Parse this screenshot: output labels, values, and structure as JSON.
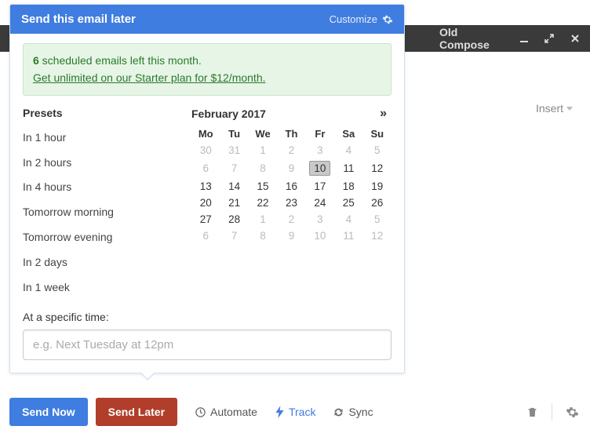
{
  "oldCompose": {
    "title": "Old Compose"
  },
  "insert": {
    "label": "Insert"
  },
  "popover": {
    "title": "Send this email later",
    "customize": "Customize"
  },
  "promo": {
    "count": "6",
    "rest": " scheduled emails left this month.",
    "link": "Get unlimited on our Starter plan for $12/month."
  },
  "presets": {
    "header": "Presets",
    "items": [
      "In 1 hour",
      "In 2 hours",
      "In 4 hours",
      "Tomorrow morning",
      "Tomorrow evening",
      "In 2 days",
      "In 1 week"
    ]
  },
  "calendar": {
    "month": "February 2017",
    "next": "»",
    "dow": [
      "Mo",
      "Tu",
      "We",
      "Th",
      "Fr",
      "Sa",
      "Su"
    ],
    "selected": 10,
    "rows": [
      [
        {
          "d": 30,
          "o": true
        },
        {
          "d": 31,
          "o": true
        },
        {
          "d": 1,
          "o": true
        },
        {
          "d": 2,
          "o": true
        },
        {
          "d": 3,
          "o": true
        },
        {
          "d": 4,
          "o": true
        },
        {
          "d": 5,
          "o": true
        }
      ],
      [
        {
          "d": 6,
          "o": true
        },
        {
          "d": 7,
          "o": true
        },
        {
          "d": 8,
          "o": true
        },
        {
          "d": 9,
          "o": true
        },
        {
          "d": 10
        },
        {
          "d": 11
        },
        {
          "d": 12
        }
      ],
      [
        {
          "d": 13
        },
        {
          "d": 14
        },
        {
          "d": 15
        },
        {
          "d": 16
        },
        {
          "d": 17
        },
        {
          "d": 18
        },
        {
          "d": 19
        }
      ],
      [
        {
          "d": 20
        },
        {
          "d": 21
        },
        {
          "d": 22
        },
        {
          "d": 23
        },
        {
          "d": 24
        },
        {
          "d": 25
        },
        {
          "d": 26
        }
      ],
      [
        {
          "d": 27
        },
        {
          "d": 28
        },
        {
          "d": 1,
          "o": true
        },
        {
          "d": 2,
          "o": true
        },
        {
          "d": 3,
          "o": true
        },
        {
          "d": 4,
          "o": true
        },
        {
          "d": 5,
          "o": true
        }
      ],
      [
        {
          "d": 6,
          "o": true
        },
        {
          "d": 7,
          "o": true
        },
        {
          "d": 8,
          "o": true
        },
        {
          "d": 9,
          "o": true
        },
        {
          "d": 10,
          "o": true
        },
        {
          "d": 11,
          "o": true
        },
        {
          "d": 12,
          "o": true
        }
      ]
    ]
  },
  "specific": {
    "label": "At a specific time:",
    "placeholder": "e.g. Next Tuesday at 12pm"
  },
  "toolbar": {
    "sendNow": "Send Now",
    "sendLater": "Send Later",
    "automate": "Automate",
    "track": "Track",
    "sync": "Sync"
  }
}
